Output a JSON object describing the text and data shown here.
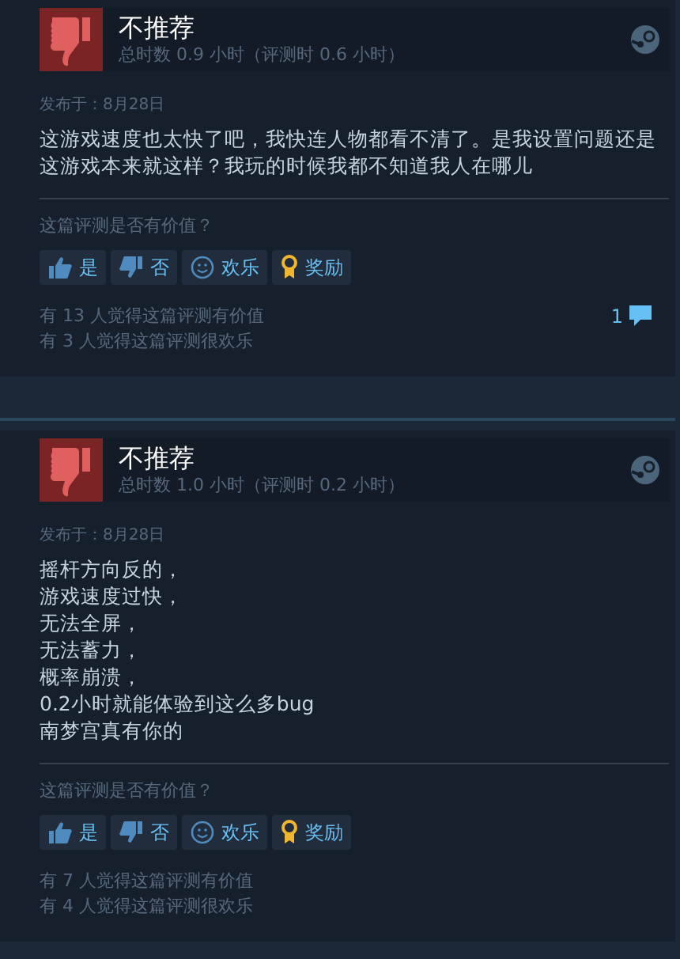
{
  "reviews": [
    {
      "recommended": false,
      "verdict": "不推荐",
      "hours": "总时数 0.9 小时（评测时 0.6 小时）",
      "posted": "发布于：8月28日",
      "body": [
        "这游戏速度也太快了吧，我快连人物都看不清了。是我设置问题还是这游戏本来就这样？我玩的时候我都不知道我人在哪儿"
      ],
      "question": "这篇评测是否有价值？",
      "buttons": [
        {
          "kind": "yes",
          "label": "是"
        },
        {
          "kind": "no",
          "label": "否"
        },
        {
          "kind": "funny",
          "label": "欢乐"
        },
        {
          "kind": "award",
          "label": "奖励"
        }
      ],
      "helpful": "有 13 人觉得这篇评测有价值",
      "funny": "有 3 人觉得这篇评测很欢乐",
      "comments": "1"
    },
    {
      "recommended": false,
      "verdict": "不推荐",
      "hours": "总时数 1.0 小时（评测时 0.2 小时）",
      "posted": "发布于：8月28日",
      "body": [
        "摇杆方向反的，",
        "游戏速度过快，",
        "无法全屏，",
        "无法蓄力，",
        "概率崩溃，",
        "0.2小时就能体验到这么多bug",
        "南梦宫真有你的"
      ],
      "question": "这篇评测是否有价值？",
      "buttons": [
        {
          "kind": "yes",
          "label": "是"
        },
        {
          "kind": "no",
          "label": "否"
        },
        {
          "kind": "funny",
          "label": "欢乐"
        },
        {
          "kind": "award",
          "label": "奖励"
        }
      ],
      "helpful": "有 7 人觉得这篇评测有价值",
      "funny": "有 4 人觉得这篇评测很欢乐"
    }
  ]
}
